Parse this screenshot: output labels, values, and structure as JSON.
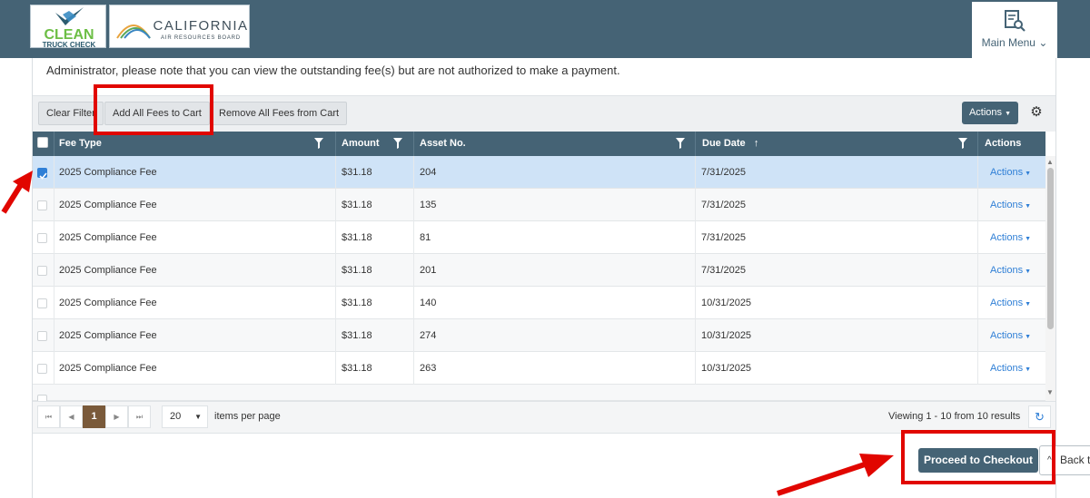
{
  "header": {
    "clean_logo_line1": "CLEAN",
    "clean_logo_line2": "TRUCK CHECK",
    "carb_logo_line1": "CALIFORNIA",
    "carb_logo_line2": "AIR RESOURCES BOARD",
    "main_menu_label": "Main Menu"
  },
  "notice": {
    "text": "Administrator, please note that you can view the outstanding fee(s) but are not authorized to make a payment."
  },
  "toolbar": {
    "clear_filter": "Clear Filter",
    "add_all": "Add All Fees to Cart",
    "remove_all": "Remove All Fees from Cart",
    "actions": "Actions"
  },
  "table": {
    "columns": [
      "Fee Type",
      "Amount",
      "Asset No.",
      "Due Date",
      "Actions"
    ],
    "due_sort_indicator": "↑",
    "row_action_label": "Actions",
    "rows": [
      {
        "fee_type": "2025 Compliance Fee",
        "amount": "$31.18",
        "asset": "204",
        "due": "7/31/2025",
        "selected": true
      },
      {
        "fee_type": "2025 Compliance Fee",
        "amount": "$31.18",
        "asset": "135",
        "due": "7/31/2025",
        "selected": false
      },
      {
        "fee_type": "2025 Compliance Fee",
        "amount": "$31.18",
        "asset": "81",
        "due": "7/31/2025",
        "selected": false
      },
      {
        "fee_type": "2025 Compliance Fee",
        "amount": "$31.18",
        "asset": "201",
        "due": "7/31/2025",
        "selected": false
      },
      {
        "fee_type": "2025 Compliance Fee",
        "amount": "$31.18",
        "asset": "140",
        "due": "10/31/2025",
        "selected": false
      },
      {
        "fee_type": "2025 Compliance Fee",
        "amount": "$31.18",
        "asset": "274",
        "due": "10/31/2025",
        "selected": false
      },
      {
        "fee_type": "2025 Compliance Fee",
        "amount": "$31.18",
        "asset": "263",
        "due": "10/31/2025",
        "selected": false
      }
    ]
  },
  "pager": {
    "current_page": "1",
    "page_size": "20",
    "page_size_label": "items per page",
    "info": "Viewing 1 - 10 from 10 results"
  },
  "footer": {
    "checkout": "Proceed to Checkout",
    "back": "Back t"
  },
  "colors": {
    "header": "#456375",
    "link": "#2f7fd6",
    "annotation": "#e10600",
    "selected_row": "#cfe3f7"
  }
}
